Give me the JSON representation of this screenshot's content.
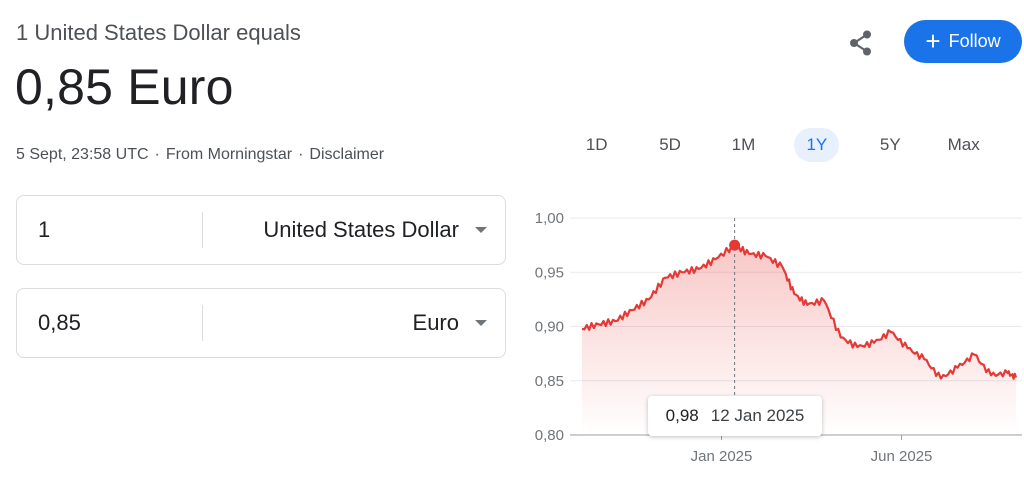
{
  "header": {
    "subtitle": "1 United States Dollar equals",
    "value": "0,85 Euro",
    "timestamp": "5 Sept, 23:58 UTC",
    "separator": "·",
    "source": "From Morningstar",
    "disclaimer": "Disclaimer"
  },
  "actions": {
    "share_icon": "share-icon",
    "follow_label": "Follow",
    "follow_color": "#1a73e8"
  },
  "converter": {
    "from": {
      "amount": "1",
      "currency": "United States Dollar"
    },
    "to": {
      "amount": "0,85",
      "currency": "Euro"
    }
  },
  "range_tabs": [
    "1D",
    "5D",
    "1M",
    "1Y",
    "5Y",
    "Max"
  ],
  "active_tab": "1Y",
  "tooltip": {
    "value": "0,98",
    "date": "12 Jan 2025"
  },
  "chart_data": {
    "type": "area",
    "line_color": "#e53935",
    "y_ticks": [
      "1,00",
      "0,95",
      "0,90",
      "0,85",
      "0,80"
    ],
    "ylim": [
      0.8,
      1.0
    ],
    "x_tick_labels": [
      "Jan 2025",
      "Jun 2025"
    ],
    "grid": true,
    "series": [
      {
        "x": [
          "2024-09-06",
          "2024-09-20",
          "2024-10-04",
          "2024-10-18",
          "2024-11-01",
          "2024-11-15",
          "2024-11-29",
          "2024-12-13",
          "2024-12-27",
          "2025-01-12",
          "2025-01-24",
          "2025-02-07",
          "2025-02-21",
          "2025-03-03",
          "2025-03-14",
          "2025-03-28",
          "2025-04-11",
          "2025-04-25",
          "2025-05-09",
          "2025-05-23",
          "2025-06-06",
          "2025-06-20",
          "2025-07-04",
          "2025-07-18",
          "2025-08-01",
          "2025-08-15",
          "2025-08-29",
          "2025-09-05"
        ],
        "values": [
          0.898,
          0.902,
          0.905,
          0.915,
          0.925,
          0.945,
          0.95,
          0.953,
          0.962,
          0.975,
          0.967,
          0.965,
          0.955,
          0.93,
          0.92,
          0.924,
          0.89,
          0.881,
          0.885,
          0.895,
          0.88,
          0.87,
          0.852,
          0.862,
          0.874,
          0.855,
          0.857,
          0.853
        ]
      }
    ],
    "highlight": {
      "x": "2025-01-12",
      "value": 0.975
    }
  }
}
